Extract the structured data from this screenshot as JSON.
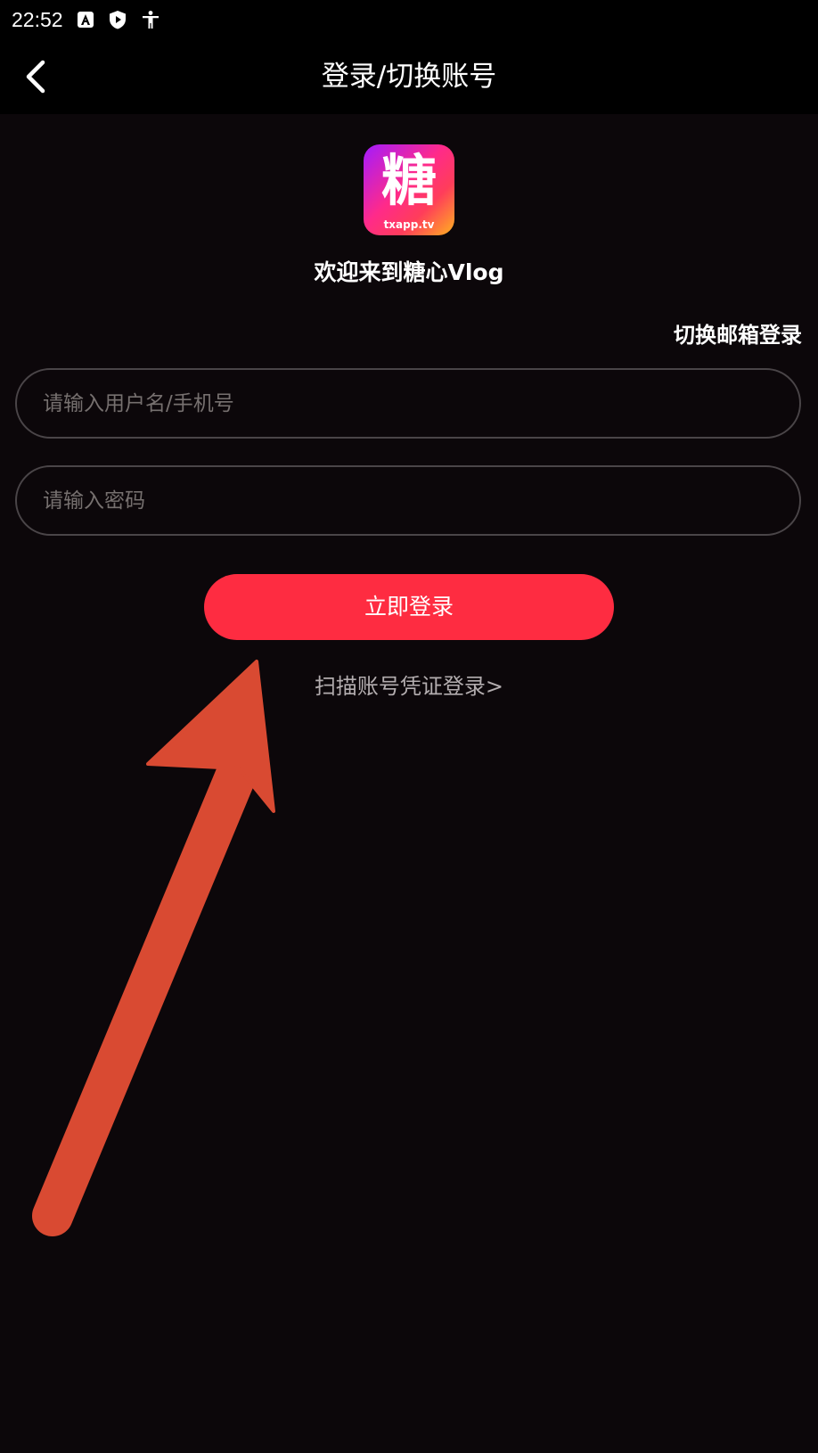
{
  "status_bar": {
    "time": "22:52",
    "icons": [
      "a-notification-icon",
      "shield-play-icon",
      "accessibility-icon"
    ]
  },
  "nav": {
    "title": "登录/切换账号",
    "back_icon": "chevron-left-icon"
  },
  "logo": {
    "char": "糖",
    "url": "txapp.tv"
  },
  "welcome": "欢迎来到糖心Vlog",
  "switch_email": "切换邮箱登录",
  "form": {
    "username_placeholder": "请输入用户名/手机号",
    "password_placeholder": "请输入密码",
    "login_label": "立即登录"
  },
  "scan_link": "扫描账号凭证登录>",
  "colors": {
    "background": "#0c070a",
    "accent": "#fe2c41",
    "annotation_arrow": "#d94a32"
  }
}
